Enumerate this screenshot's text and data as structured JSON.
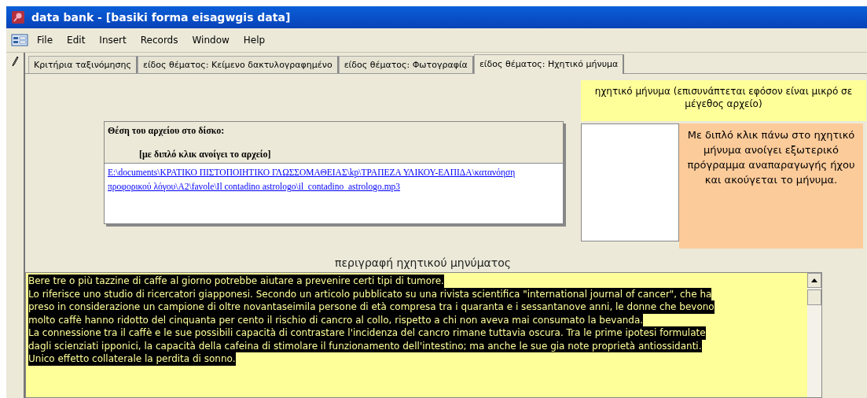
{
  "window": {
    "title": "data bank - [basiki forma eisagwgis data]"
  },
  "menu": [
    "File",
    "Edit",
    "Insert",
    "Records",
    "Window",
    "Help"
  ],
  "tabs": [
    {
      "label": "Κριτήρια ταξινόμησης",
      "selected": false
    },
    {
      "label": "είδος θέματος: Κείμενο δακτυλογραφημένο",
      "selected": false
    },
    {
      "label": "είδος θέματος: Φωτογραφία",
      "selected": false
    },
    {
      "label": "είδος θέματος: Ηχητικό μήνυμα",
      "selected": true
    }
  ],
  "audio_caption": "ηχητικό μήνυμα (επισυνάπτεται εφόσον είναι μικρό σε μέγεθος αρχείο)",
  "file_location": {
    "title": "Θέση του αρχείου στο δίσκο:",
    "hint": "[με διπλό κλικ ανοίγει το αρχείο]",
    "path": "E:\\documents\\ΚΡΑΤΙΚΟ ΠΙΣΤΟΠΟΙΗΤΙΚΟ ΓΛΩΣΣΟΜΑΘΕΙΑΣ\\kp\\ΤΡΑΠΕΖΑ ΥΛΙΚΟΥ-ΕΛΠΙΔΑ\\κατανόηση προφορικού λόγου\\A2\\favole\\Il contadino astrologo\\il_contadino_astrologo.mp3"
  },
  "audio_note": "Με διπλό κλικ πάνω στο ηχητικό μήνυμα ανοίγει εξωτερικό πρόγραμμα αναπαραγωγής ήχου και ακούγεται το μήνυμα.",
  "description": {
    "label": "περιγραφή ηχητικού μηνύματος",
    "selected": true,
    "lines": [
      "Bere tre o più tazzine di caffe al giorno potrebbe aiutare a prevenire certi tipi di tumore.",
      "Lo riferisce uno studio di ricercatori giapponesi. Secondo un articolo pubblicato su una rivista scientifica \"international journal of cancer\", che ha",
      "preso in considerazione un campione di oltre novantaseimila persone di età compresa tra i quaranta e i sessantanove anni, le donne che bevono",
      "molto caffè hanno ridotto del cinquanta per cento il rischio di cancro al collo, rispetto a chi non aveva mai consumato la bevanda.",
      "La connessione tra il caffè e le sue possibili capacità di contrastare l'incidenza del cancro rimane tuttavia oscura. Tra le prime ipotesi formulate",
      "dagli scienziati ipponici, la capacità della cafeina di stimolare il funzionamento dell'intestino; ma anche le sue gia note proprietà antiossidanti.",
      "Unico effetto collaterale la perdita di sonno."
    ]
  }
}
